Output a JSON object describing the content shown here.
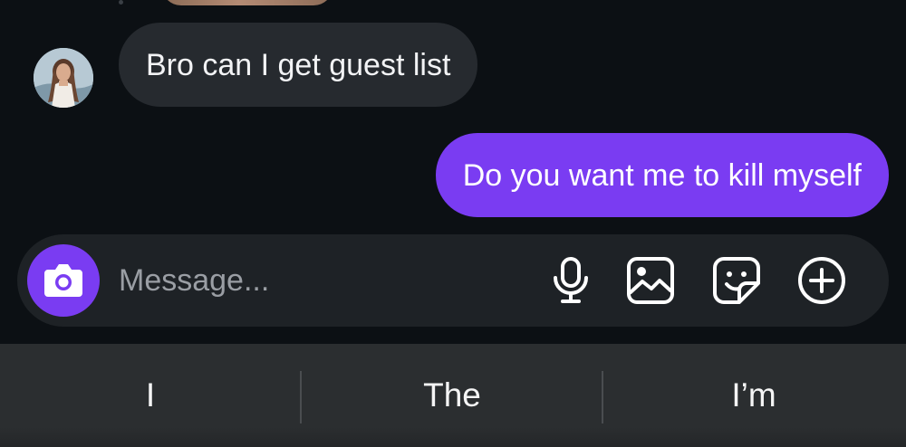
{
  "thread": {
    "incoming_message": "Bro can I get guest list",
    "outgoing_message": "Do you want me to kill myself"
  },
  "composer": {
    "placeholder": "Message...",
    "icons": [
      "camera-icon",
      "microphone-icon",
      "gallery-icon",
      "sticker-icon",
      "plus-icon"
    ]
  },
  "suggestions": [
    "I",
    "The",
    "I’m"
  ],
  "colors": {
    "background": "#0c1014",
    "incoming_bubble": "#262a2f",
    "outgoing_bubble": "#7a3cf2",
    "composer": "#1e2226",
    "suggest_bar": "#2b2e30"
  }
}
